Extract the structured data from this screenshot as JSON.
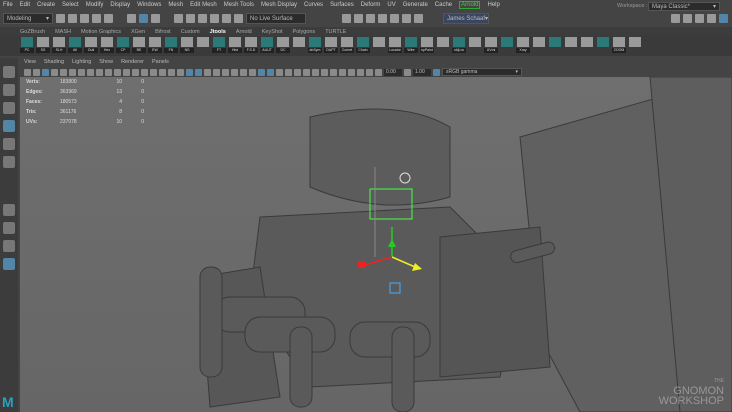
{
  "menu": [
    "File",
    "Edit",
    "Create",
    "Select",
    "Modify",
    "Display",
    "Windows",
    "Mesh",
    "Edit Mesh",
    "Mesh Tools",
    "Mesh Display",
    "Curves",
    "Surfaces",
    "Deform",
    "UV",
    "Generate",
    "Cache",
    "Arnold",
    "Help"
  ],
  "status": {
    "mode": "Modeling",
    "live_surface": "No Live Surface",
    "user": "James Schaaf",
    "workspace_label": "Workspace :",
    "workspace": "Maya Classic*"
  },
  "shelf_tabs": [
    "GoZBrush",
    "MASH",
    "Motion Graphics",
    "XGen",
    "Bifrost",
    "Custom",
    "Jtools",
    "Arnold",
    "KeyShot",
    "Polygons",
    "TURTLE"
  ],
  "active_shelf_tab": "Jtools",
  "shelf_buttons": [
    "PC",
    "SS",
    "SLH",
    "All",
    "Outl",
    "Hex",
    "CP",
    "BE",
    "EW",
    "FN",
    "NS",
    "",
    "FT",
    "Hist",
    "F.S.D",
    "AUUT",
    "DC",
    "",
    "abSym",
    "DAPT",
    "Comet",
    "Chain",
    "",
    "Locator",
    "Wire",
    "spPaint",
    "",
    "objLoc",
    "",
    "UVmi",
    "",
    "Xray",
    "",
    "",
    "",
    "",
    "",
    "ZOOM",
    ""
  ],
  "panel_menu": [
    "View",
    "Shading",
    "Lighting",
    "Show",
    "Renderer",
    "Panels"
  ],
  "panel_toolbar": {
    "exposure": "0.00",
    "gamma": "1.00",
    "color_space": "sRGB gamma"
  },
  "hud": [
    {
      "label": "Verts:",
      "total": "183800",
      "selected": "10",
      "other": "0"
    },
    {
      "label": "Edges:",
      "total": "363969",
      "selected": "13",
      "other": "0"
    },
    {
      "label": "Faces:",
      "total": "180573",
      "selected": "4",
      "other": "0"
    },
    {
      "label": "Tris:",
      "total": "361176",
      "selected": "8",
      "other": "0"
    },
    {
      "label": "UVs:",
      "total": "237078",
      "selected": "10",
      "other": "0"
    }
  ],
  "watermark": {
    "small": "THE",
    "line1": "GNOMON",
    "line2": "WORKSHOP"
  },
  "logo": "M"
}
